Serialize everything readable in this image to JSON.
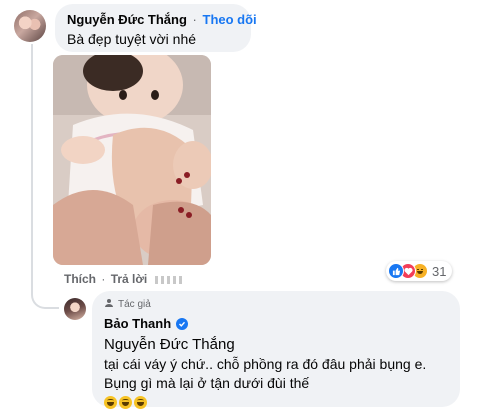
{
  "comment1": {
    "author": "Nguyễn Đức Thắng",
    "separator": "·",
    "follow_label": "Theo dõi",
    "text": "Bà đẹp tuyệt vời nhé"
  },
  "actions1": {
    "like_label": "Thích",
    "reply_label": "Trả lời"
  },
  "reactions": {
    "icons": [
      "like-icon",
      "love-icon",
      "haha-icon"
    ],
    "count": "31"
  },
  "reply": {
    "badge_icon": "author-badge-icon",
    "badge_label": "Tác giả",
    "author": "Bảo Thanh",
    "verified_icon": "verified-icon",
    "mention": "Nguyễn Đức Thắng",
    "line1": "tại cái váy ý chứ.. chỗ phồng ra đó đâu phải bụng e.",
    "line2": "Bụng gì mà lại ở tận dưới đùi thế",
    "emojis": [
      "laughing-emoji",
      "laughing-emoji",
      "laughing-emoji"
    ]
  },
  "colors": {
    "bubble_bg": "#f0f2f5",
    "accent": "#1877f2",
    "secondary_text": "#65676b"
  }
}
